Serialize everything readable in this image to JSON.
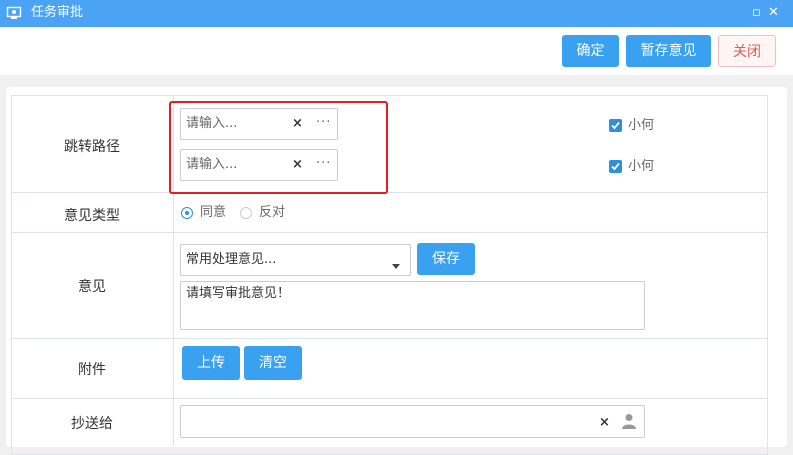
{
  "window": {
    "title": "任务审批",
    "restore_glyph": "▫",
    "close_glyph": "✕"
  },
  "toolbar": {
    "confirm_label": "确定",
    "save_draft_label": "暂存意见",
    "close_label": "关闭"
  },
  "form": {
    "route": {
      "label": "跳转路径",
      "rows": [
        {
          "placeholder": "请输入...",
          "clear_glyph": "×",
          "more_glyph": "···",
          "checkbox_label": "小何",
          "checked": true
        },
        {
          "placeholder": "请输入...",
          "clear_glyph": "×",
          "more_glyph": "···",
          "checkbox_label": "小何",
          "checked": true
        }
      ]
    },
    "opinion_type": {
      "label": "意见类型",
      "options": [
        "同意",
        "反对"
      ],
      "selected": "同意"
    },
    "opinion": {
      "label": "意见",
      "common_select": "常用处理意见...",
      "save_label": "保存",
      "textarea_placeholder": "请填写审批意见！"
    },
    "attachment": {
      "label": "附件",
      "upload_label": "上传",
      "clear_label": "清空"
    },
    "cc": {
      "label": "抄送给",
      "clear_glyph": "×",
      "value": ""
    }
  },
  "colors": {
    "title_bar": "#4aa3f5",
    "primary": "#3aa0f0",
    "danger_text": "#e05a5a",
    "checkbox": "#2f8fd8",
    "highlight_box": "#e02020"
  },
  "icons": [
    "window-icon",
    "restore-icon",
    "close-icon",
    "clear-icon",
    "more-icon",
    "checkbox-icon",
    "dropdown-caret-icon",
    "user-icon"
  ]
}
